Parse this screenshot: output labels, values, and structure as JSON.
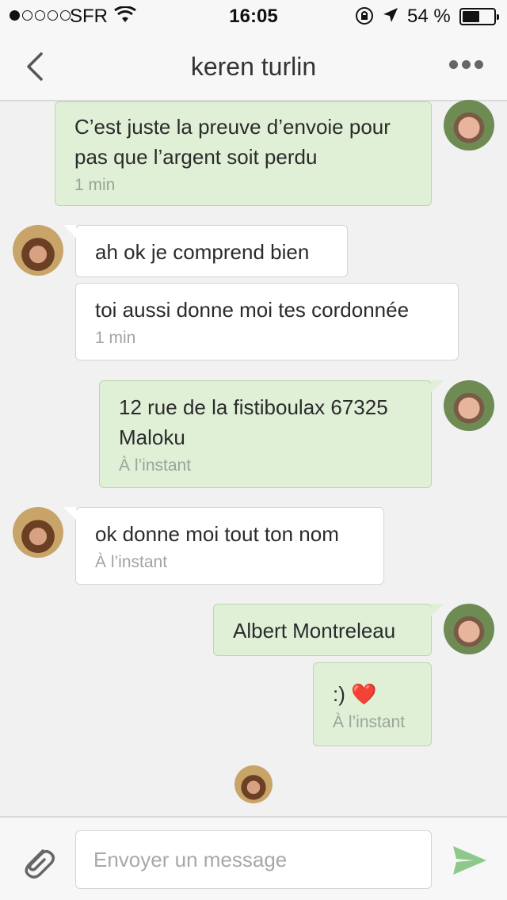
{
  "status_bar": {
    "carrier": "SFR",
    "time": "16:05",
    "battery": "54 %",
    "battery_level": 0.54,
    "signal_bars": 1
  },
  "header": {
    "title": "keren turlin",
    "back_icon": "chevron-left-icon",
    "more_icon": "more-dots-icon"
  },
  "messages": [
    {
      "text": "C’est juste la preuve d’envoie pour pas que l’argent soit perdu",
      "time": "1 min"
    },
    {
      "text": "ah ok je comprend bien"
    },
    {
      "text": "toi aussi donne moi tes cordonnée",
      "time": "1 min"
    },
    {
      "text": "12 rue de la fistiboulax 67325 Maloku",
      "time": "À l’instant"
    },
    {
      "text": "ok donne moi tout ton nom",
      "time": "À l’instant"
    },
    {
      "text": "Albert Montreleau"
    },
    {
      "text": ":) ❤️",
      "time": "À l’instant"
    }
  ],
  "composer": {
    "placeholder": "Envoyer un message",
    "attach_icon": "paperclip-icon",
    "send_icon": "send-icon"
  },
  "colors": {
    "outgoing_bubble": "#dff0d7",
    "incoming_bubble": "#ffffff",
    "send_accent": "#8dc98a"
  }
}
